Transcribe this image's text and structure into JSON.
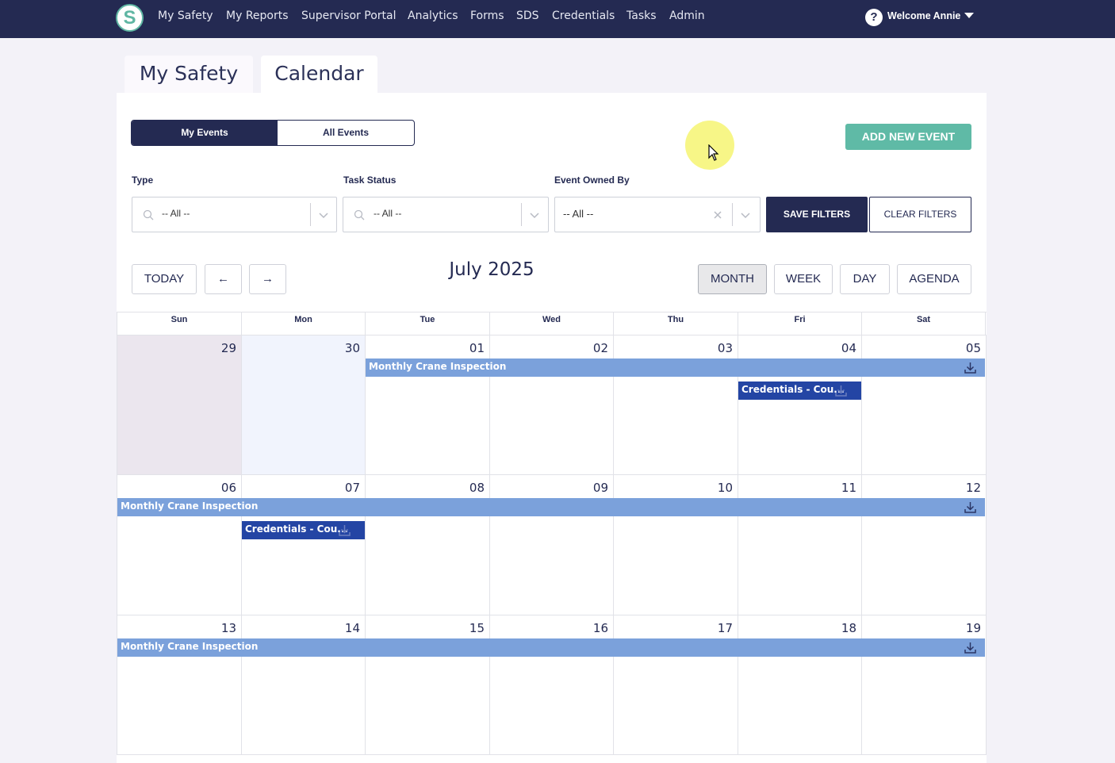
{
  "nav": {
    "logo_letter": "S",
    "items": [
      "My Safety",
      "My Reports",
      "Supervisor Portal",
      "Analytics",
      "Forms",
      "SDS",
      "Credentials",
      "Tasks",
      "Admin"
    ],
    "welcome": "Welcome Annie"
  },
  "tabs": [
    "My Safety",
    "Calendar"
  ],
  "toggle": {
    "my_events": "My Events",
    "all_events": "All Events"
  },
  "add_event_label": "ADD NEW EVENT",
  "filters": {
    "type_label": "Type",
    "type_value": "-- All --",
    "status_label": "Task Status",
    "status_value": "-- All --",
    "owner_label": "Event Owned By",
    "owner_value": "-- All --",
    "save_label": "SAVE FILTERS",
    "clear_label": "CLEAR FILTERS"
  },
  "toolbar": {
    "today": "TODAY",
    "prev": "←",
    "next": "→",
    "title": "July 2025",
    "views": [
      "MONTH",
      "WEEK",
      "DAY",
      "AGENDA"
    ],
    "active_view": "MONTH"
  },
  "calendar": {
    "days_of_week": [
      "Sun",
      "Mon",
      "Tue",
      "Wed",
      "Thu",
      "Fri",
      "Sat"
    ],
    "weeks": [
      [
        "29",
        "30",
        "01",
        "02",
        "03",
        "04",
        "05"
      ],
      [
        "06",
        "07",
        "08",
        "09",
        "10",
        "11",
        "12"
      ],
      [
        "13",
        "14",
        "15",
        "16",
        "17",
        "18",
        "19"
      ]
    ],
    "events": {
      "crane": "Monthly Crane Inspection",
      "credentials": "Credentials - Cou..."
    }
  },
  "colors": {
    "nav_bg": "#242a52",
    "accent_green": "#5fbaa6",
    "event_light": "#7ba1db",
    "event_dark": "#2445a4"
  }
}
